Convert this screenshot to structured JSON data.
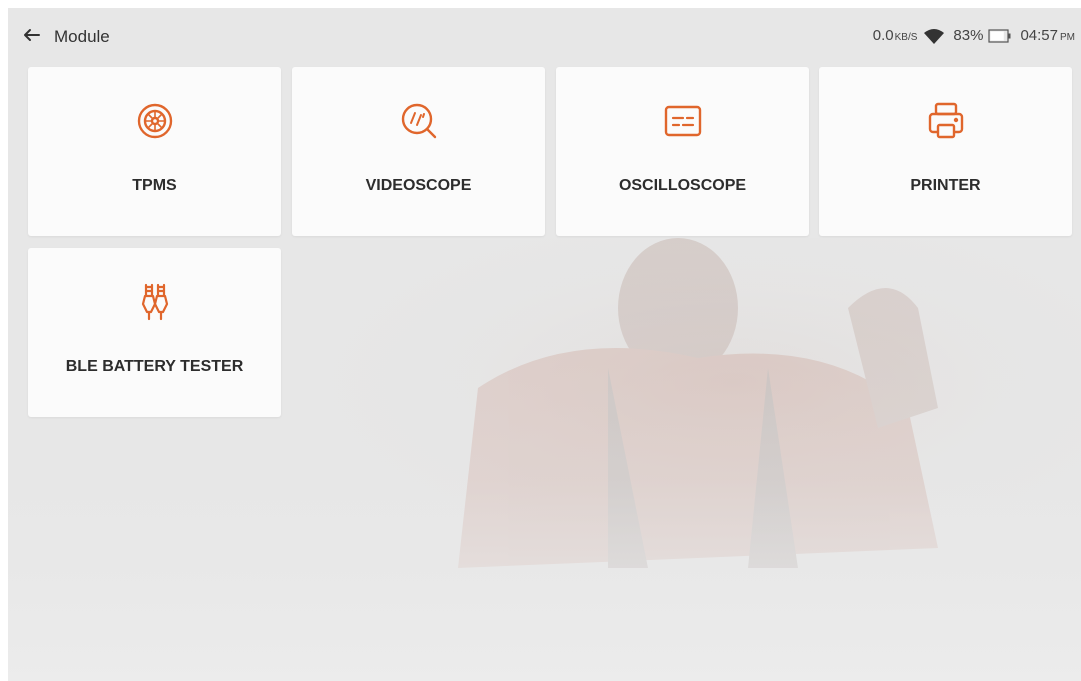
{
  "header": {
    "back_icon": "arrow-left-icon",
    "title": "Module"
  },
  "status_bar": {
    "net_speed_value": "0.0",
    "net_speed_unit": "KB/S",
    "wifi_icon": "wifi-icon",
    "battery_percent": "83%",
    "battery_icon": "battery-icon",
    "battery_level": 0.83,
    "time": "04:57",
    "ampm": "PM"
  },
  "modules": [
    {
      "label": "TPMS",
      "icon": "tire-icon"
    },
    {
      "label": "VIDEOSCOPE",
      "icon": "videoscope-icon"
    },
    {
      "label": "OSCILLOSCOPE",
      "icon": "oscilloscope-icon"
    },
    {
      "label": "PRINTER",
      "icon": "printer-icon"
    },
    {
      "label": "BLE BATTERY TESTER",
      "icon": "battery-clamp-icon"
    }
  ],
  "colors": {
    "accent": "#e0662c",
    "background": "#e7e7e7",
    "tile": "#fbfbfb",
    "text": "#2d2d2d"
  }
}
